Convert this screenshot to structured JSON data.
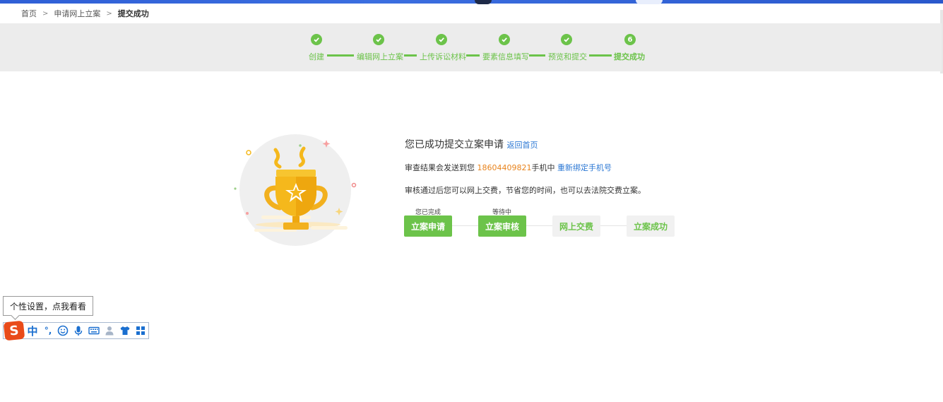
{
  "breadcrumb": {
    "items": [
      "首页",
      "申请网上立案"
    ],
    "current": "提交成功"
  },
  "steps": {
    "items": [
      {
        "label": "创建",
        "status": "done"
      },
      {
        "label": "编辑网上立案",
        "status": "done"
      },
      {
        "label": "上传诉讼材料",
        "status": "done"
      },
      {
        "label": "要素信息填写",
        "status": "done"
      },
      {
        "label": "预览和提交",
        "status": "done"
      },
      {
        "label": "提交成功",
        "status": "current",
        "number": "6"
      }
    ]
  },
  "result": {
    "title": "您已成功提交立案申请",
    "home_link": "返回首页",
    "notice_prefix": "审查结果会发送到您",
    "phone": "18604409821",
    "notice_suffix": "手机中",
    "rebind_link": "重新绑定手机号",
    "hint": "审核通过后您可以网上交费，节省您的时间，也可以去法院交费立案。"
  },
  "progress": {
    "items": [
      {
        "label": "立案申请",
        "status": "done",
        "caption": "您已完成"
      },
      {
        "label": "立案审核",
        "status": "done",
        "caption": "等待中"
      },
      {
        "label": "网上交费",
        "status": "todo",
        "caption": ""
      },
      {
        "label": "立案成功",
        "status": "todo",
        "caption": ""
      }
    ]
  },
  "ime": {
    "tooltip": "个性设置，点我看看",
    "logo": "S",
    "lang": "中",
    "punct": "°,",
    "icons": [
      "emoji-icon",
      "microphone-icon",
      "keyboard-icon",
      "user-icon",
      "shirt-icon",
      "grid-icon"
    ]
  },
  "colors": {
    "accent": "#6cc34a",
    "link": "#2c78d4",
    "phone": "#e8831c",
    "topbar": "#2f5fd6",
    "ime_logo": "#e94b1a"
  }
}
